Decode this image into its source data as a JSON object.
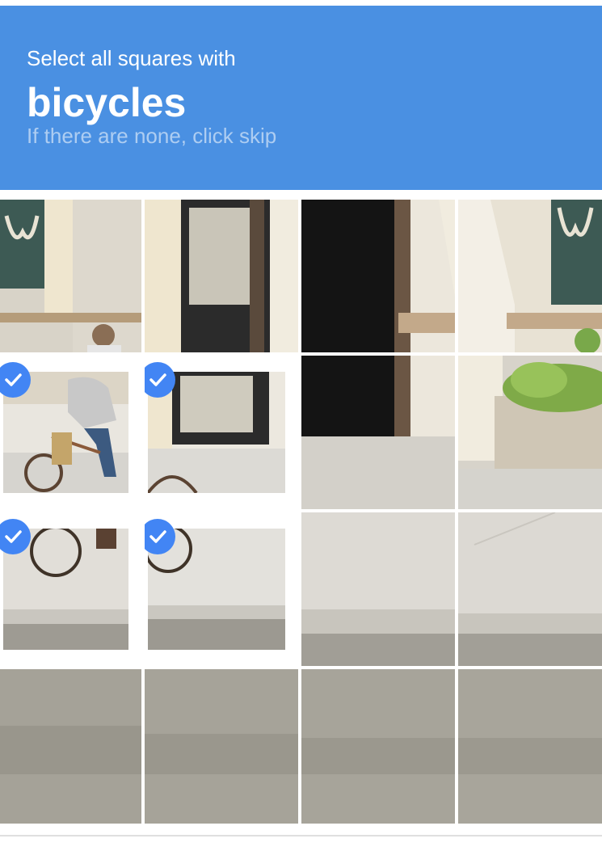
{
  "challenge": {
    "instruction": "Select all squares with",
    "target": "bicycles",
    "skip_hint": "If there are none, click skip"
  },
  "grid": {
    "rows": 4,
    "columns": 4,
    "tiles": [
      {
        "row": 1,
        "col": 1,
        "selected": false,
        "content": "building-wall-person-head"
      },
      {
        "row": 1,
        "col": 2,
        "selected": false,
        "content": "building-doorway"
      },
      {
        "row": 1,
        "col": 3,
        "selected": false,
        "content": "dark-doorway-pillar"
      },
      {
        "row": 1,
        "col": 4,
        "selected": false,
        "content": "building-pillar-window"
      },
      {
        "row": 2,
        "col": 1,
        "selected": true,
        "content": "cyclist-rider"
      },
      {
        "row": 2,
        "col": 2,
        "selected": true,
        "content": "bicycle-wheel-doorway"
      },
      {
        "row": 2,
        "col": 3,
        "selected": false,
        "content": "sidewalk-dark-doorway"
      },
      {
        "row": 2,
        "col": 4,
        "selected": false,
        "content": "planter-shrubs"
      },
      {
        "row": 3,
        "col": 1,
        "selected": true,
        "content": "bicycle-wheels-sidewalk"
      },
      {
        "row": 3,
        "col": 2,
        "selected": true,
        "content": "bicycle-wheel-curb"
      },
      {
        "row": 3,
        "col": 3,
        "selected": false,
        "content": "sidewalk-curb"
      },
      {
        "row": 3,
        "col": 4,
        "selected": false,
        "content": "sidewalk-curb"
      },
      {
        "row": 4,
        "col": 1,
        "selected": false,
        "content": "road"
      },
      {
        "row": 4,
        "col": 2,
        "selected": false,
        "content": "road"
      },
      {
        "row": 4,
        "col": 3,
        "selected": false,
        "content": "road"
      },
      {
        "row": 4,
        "col": 4,
        "selected": false,
        "content": "road"
      }
    ]
  },
  "colors": {
    "header_bg": "#4a90e2",
    "check_badge": "#4285f4"
  },
  "icons": {
    "selected_marker": "check-circle-icon"
  }
}
